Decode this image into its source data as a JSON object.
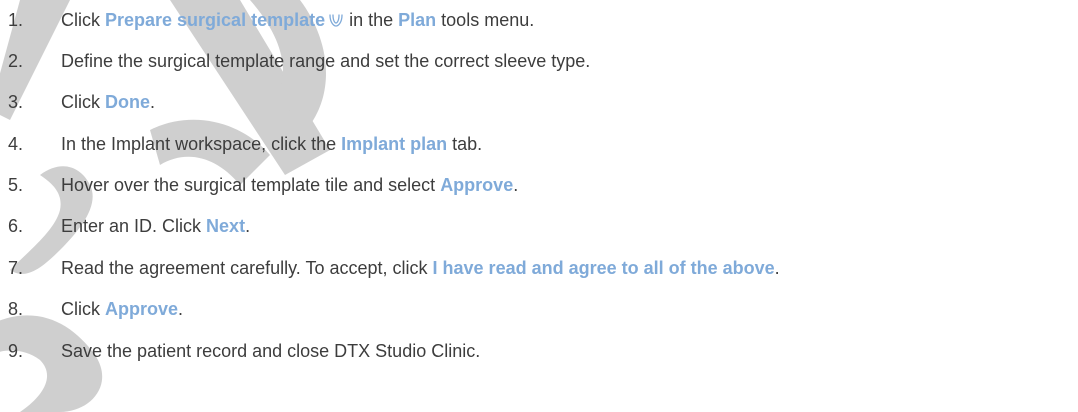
{
  "watermark": {
    "text": "SUPPLEMENT",
    "color": "#a8a8a8"
  },
  "colors": {
    "body_text": "#3d3d3d",
    "ui_reference": "#7faad9"
  },
  "steps": [
    {
      "number": "1.",
      "parts": [
        {
          "text": "Click "
        },
        {
          "text": "Prepare surgical template",
          "ui": true
        },
        {
          "icon": "surgical-template-icon"
        },
        {
          "text": " in the "
        },
        {
          "text": "Plan",
          "ui": true
        },
        {
          "text": " tools menu."
        }
      ]
    },
    {
      "number": "2.",
      "parts": [
        {
          "text": "Define the surgical template range and set the correct sleeve type."
        }
      ]
    },
    {
      "number": "3.",
      "parts": [
        {
          "text": "Click "
        },
        {
          "text": "Done",
          "ui": true
        },
        {
          "text": "."
        }
      ]
    },
    {
      "number": "4.",
      "parts": [
        {
          "text": "In the Implant workspace, click the "
        },
        {
          "text": "Implant plan",
          "ui": true
        },
        {
          "text": " tab."
        }
      ]
    },
    {
      "number": "5.",
      "parts": [
        {
          "text": "Hover over the surgical template tile and select "
        },
        {
          "text": "Approve",
          "ui": true
        },
        {
          "text": "."
        }
      ]
    },
    {
      "number": "6.",
      "parts": [
        {
          "text": "Enter an ID. Click "
        },
        {
          "text": "Next",
          "ui": true
        },
        {
          "text": "."
        }
      ]
    },
    {
      "number": "7.",
      "parts": [
        {
          "text": "Read the agreement carefully. To accept, click "
        },
        {
          "text": "I have read and agree to all of the above",
          "ui": true
        },
        {
          "text": "."
        }
      ]
    },
    {
      "number": "8.",
      "parts": [
        {
          "text": "Click "
        },
        {
          "text": "Approve",
          "ui": true
        },
        {
          "text": "."
        }
      ]
    },
    {
      "number": "9.",
      "parts": [
        {
          "text": "Save the patient record and close DTX Studio Clinic."
        }
      ]
    }
  ]
}
